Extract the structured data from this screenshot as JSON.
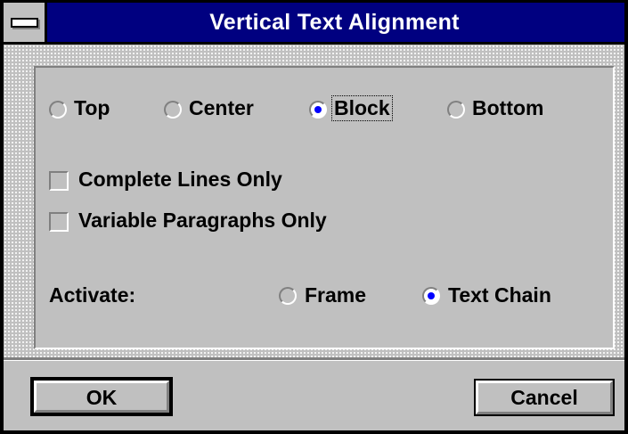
{
  "window": {
    "title": "Vertical Text Alignment"
  },
  "alignment": {
    "options": [
      {
        "label": "Top",
        "selected": false
      },
      {
        "label": "Center",
        "selected": false
      },
      {
        "label": "Block",
        "selected": true
      },
      {
        "label": "Bottom",
        "selected": false
      }
    ]
  },
  "checkboxes": [
    {
      "label": "Complete Lines Only",
      "checked": false
    },
    {
      "label": "Variable Paragraphs Only",
      "checked": false
    }
  ],
  "activate": {
    "label": "Activate:",
    "options": [
      {
        "label": "Frame",
        "selected": false
      },
      {
        "label": "Text Chain",
        "selected": true
      }
    ]
  },
  "buttons": {
    "ok": "OK",
    "cancel": "Cancel"
  },
  "colors": {
    "titlebar": "#000080",
    "face": "#c0c0c0",
    "radio_dot": "#0000ff"
  }
}
